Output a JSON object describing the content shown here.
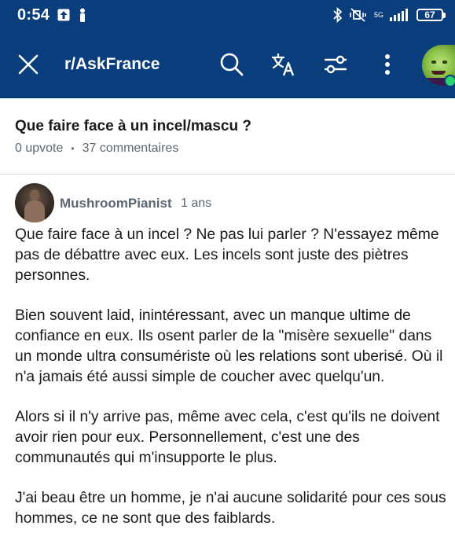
{
  "status_bar": {
    "time": "0:54",
    "network": "5G",
    "battery": "67"
  },
  "header": {
    "subreddit": "r/AskFrance"
  },
  "post": {
    "title": "Que faire face à un incel/mascu ?",
    "upvotes": "0 upvote",
    "separator": "•",
    "comments": "37 commentaires"
  },
  "comment": {
    "author": "MushroomPianist",
    "age": "1 ans",
    "paragraphs": [
      "Que faire face à un incel ? Ne pas lui parler ? N'essayez même pas de débattre avec eux. Les incels sont juste des piètres personnes.",
      "Bien souvent laid, inintéressant, avec un manque ultime de confiance en eux. Ils osent parler de la \"misère sexuelle\" dans un monde ultra consumériste où les relations sont uberisé. Où il n'a jamais été aussi simple de coucher avec quelqu'un.",
      "Alors si il n'y arrive pas, même avec cela, c'est qu'ils ne doivent avoir rien pour eux. Personnellement, c'est une des communautés qui m'insupporte le plus.",
      "J'ai beau être un homme, je n'ai aucune solidarité pour ces sous hommes, ce ne sont que des faiblards."
    ]
  },
  "icons": {
    "close": "close-icon",
    "search": "search-icon",
    "translate": "translate-icon",
    "filter": "filter-icon",
    "more": "more-vertical-icon"
  },
  "colors": {
    "header_bg": "#0a3d7c",
    "meta_text": "#5c6670",
    "online": "#2bd46b"
  }
}
